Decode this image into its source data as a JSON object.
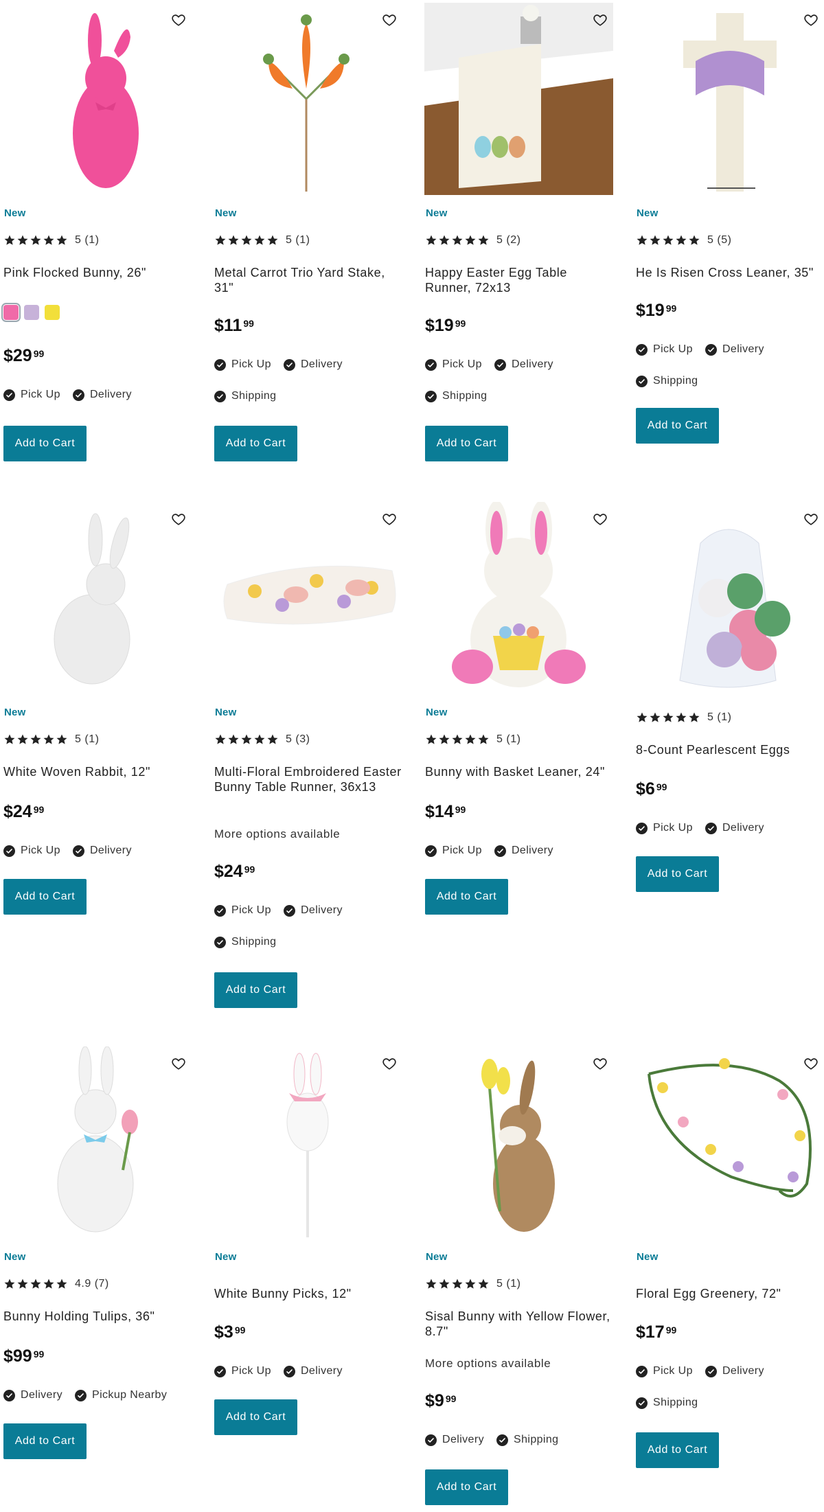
{
  "colors": {
    "accent": "#0a7c96",
    "badge": "#0a7c96",
    "text": "#222222"
  },
  "products": [
    {
      "name": "Pink Flocked Bunny, 26\"",
      "badge": "New",
      "rating": "5",
      "reviews": "(1)",
      "price_dollars": "$29",
      "price_cents": "99",
      "fulfillment": [
        "Pick Up",
        "Delivery"
      ],
      "swatches": [
        "#f06aa8",
        "#c7b2d9",
        "#f2df3a"
      ],
      "button": "Add to Cart",
      "icon": "pink-bunny-image"
    },
    {
      "name": "Metal Carrot Trio Yard Stake, 31\"",
      "badge": "New",
      "rating": "5",
      "reviews": "(1)",
      "price_dollars": "$11",
      "price_cents": "99",
      "fulfillment": [
        "Pick Up",
        "Delivery",
        "Shipping"
      ],
      "button": "Add to Cart",
      "icon": "carrot-stake-image"
    },
    {
      "name": "Happy Easter Egg Table Runner, 72x13",
      "badge": "New",
      "rating": "5",
      "reviews": "(2)",
      "price_dollars": "$19",
      "price_cents": "99",
      "fulfillment": [
        "Pick Up",
        "Delivery",
        "Shipping"
      ],
      "button": "Add to Cart",
      "icon": "table-runner-image"
    },
    {
      "name": "He Is Risen Cross Leaner, 35\"",
      "badge": "New",
      "rating": "5",
      "reviews": "(5)",
      "price_dollars": "$19",
      "price_cents": "99",
      "fulfillment": [
        "Pick Up",
        "Delivery",
        "Shipping"
      ],
      "button": "Add to Cart",
      "icon": "cross-leaner-image"
    },
    {
      "name": "White Woven Rabbit, 12\"",
      "badge": "New",
      "rating": "5",
      "reviews": "(1)",
      "price_dollars": "$24",
      "price_cents": "99",
      "fulfillment": [
        "Pick Up",
        "Delivery"
      ],
      "button": "Add to Cart",
      "icon": "woven-rabbit-image"
    },
    {
      "name": "Multi-Floral Embroidered Easter Bunny Table Runner, 36x13",
      "badge": "New",
      "rating": "5",
      "reviews": "(3)",
      "more": "More options available",
      "price_dollars": "$24",
      "price_cents": "99",
      "fulfillment": [
        "Pick Up",
        "Delivery",
        "Shipping"
      ],
      "button": "Add to Cart",
      "icon": "floral-runner-image"
    },
    {
      "name": "Bunny with Basket Leaner, 24\"",
      "badge": "New",
      "rating": "5",
      "reviews": "(1)",
      "price_dollars": "$14",
      "price_cents": "99",
      "fulfillment": [
        "Pick Up",
        "Delivery"
      ],
      "button": "Add to Cart",
      "icon": "bunny-basket-image"
    },
    {
      "name": "8-Count Pearlescent Eggs",
      "rating": "5",
      "reviews": "(1)",
      "price_dollars": "$6",
      "price_cents": "99",
      "fulfillment": [
        "Pick Up",
        "Delivery"
      ],
      "button": "Add to Cart",
      "icon": "pearl-eggs-image"
    },
    {
      "name": "Bunny Holding Tulips, 36\"",
      "badge": "New",
      "rating": "4.9",
      "reviews": "(7)",
      "price_dollars": "$99",
      "price_cents": "99",
      "fulfillment": [
        "Delivery",
        "Pickup Nearby"
      ],
      "button": "Add to Cart",
      "icon": "tulip-bunny-image"
    },
    {
      "name": "White Bunny Picks, 12\"",
      "badge": "New",
      "price_dollars": "$3",
      "price_cents": "99",
      "fulfillment": [
        "Pick Up",
        "Delivery"
      ],
      "button": "Add to Cart",
      "icon": "bunny-pick-image"
    },
    {
      "name": "Sisal Bunny with Yellow Flower, 8.7\"",
      "badge": "New",
      "rating": "5",
      "reviews": "(1)",
      "more": "More options available",
      "price_dollars": "$9",
      "price_cents": "99",
      "fulfillment": [
        "Delivery",
        "Shipping"
      ],
      "button": "Add to Cart",
      "icon": "sisal-bunny-image"
    },
    {
      "name": "Floral Egg Greenery, 72\"",
      "badge": "New",
      "price_dollars": "$17",
      "price_cents": "99",
      "fulfillment": [
        "Pick Up",
        "Delivery",
        "Shipping"
      ],
      "button": "Add to Cart",
      "icon": "egg-greenery-image"
    }
  ]
}
